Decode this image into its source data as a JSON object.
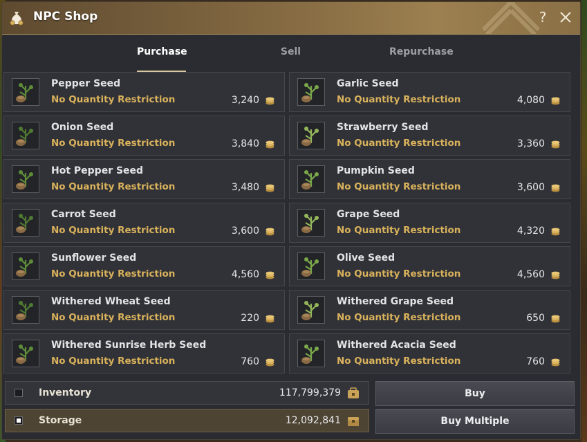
{
  "window": {
    "title": "NPC Shop"
  },
  "tabs": [
    {
      "label": "Purchase",
      "active": true
    },
    {
      "label": "Sell",
      "active": false
    },
    {
      "label": "Repurchase",
      "active": false
    }
  ],
  "items": [
    {
      "name": "Pepper Seed",
      "restriction": "No Quantity Restriction",
      "price": "3,240",
      "icon": "pepper-seed-icon"
    },
    {
      "name": "Garlic Seed",
      "restriction": "No Quantity Restriction",
      "price": "4,080",
      "icon": "garlic-seed-icon"
    },
    {
      "name": "Onion Seed",
      "restriction": "No Quantity Restriction",
      "price": "3,840",
      "icon": "onion-seed-icon"
    },
    {
      "name": "Strawberry Seed",
      "restriction": "No Quantity Restriction",
      "price": "3,360",
      "icon": "strawberry-seed-icon"
    },
    {
      "name": "Hot Pepper Seed",
      "restriction": "No Quantity Restriction",
      "price": "3,480",
      "icon": "hot-pepper-seed-icon"
    },
    {
      "name": "Pumpkin Seed",
      "restriction": "No Quantity Restriction",
      "price": "3,600",
      "icon": "pumpkin-seed-icon"
    },
    {
      "name": "Carrot Seed",
      "restriction": "No Quantity Restriction",
      "price": "3,600",
      "icon": "carrot-seed-icon"
    },
    {
      "name": "Grape Seed",
      "restriction": "No Quantity Restriction",
      "price": "4,320",
      "icon": "grape-seed-icon"
    },
    {
      "name": "Sunflower Seed",
      "restriction": "No Quantity Restriction",
      "price": "4,560",
      "icon": "sunflower-seed-icon"
    },
    {
      "name": "Olive Seed",
      "restriction": "No Quantity Restriction",
      "price": "4,560",
      "icon": "olive-seed-icon"
    },
    {
      "name": "Withered Wheat Seed",
      "restriction": "No Quantity Restriction",
      "price": "220",
      "icon": "withered-wheat-seed-icon"
    },
    {
      "name": "Withered Grape Seed",
      "restriction": "No Quantity Restriction",
      "price": "650",
      "icon": "withered-grape-seed-icon"
    },
    {
      "name": "Withered Sunrise Herb Seed",
      "restriction": "No Quantity Restriction",
      "price": "760",
      "icon": "withered-sunrise-herb-seed-icon"
    },
    {
      "name": "Withered Acacia Seed",
      "restriction": "No Quantity Restriction",
      "price": "760",
      "icon": "withered-acacia-seed-icon"
    }
  ],
  "funds": {
    "inventory": {
      "label": "Inventory",
      "value": "117,799,379",
      "checked": false,
      "icon": "inventory-bag-icon"
    },
    "storage": {
      "label": "Storage",
      "value": "12,092,841",
      "checked": true,
      "icon": "storage-chest-icon"
    }
  },
  "actions": {
    "buy_label": "Buy",
    "buy_multiple_label": "Buy Multiple"
  },
  "colors": {
    "restriction_text": "#d9b25b",
    "titlebar": "#8a6f45",
    "panel": "#2b2c31",
    "coin": "#d8b25e"
  }
}
